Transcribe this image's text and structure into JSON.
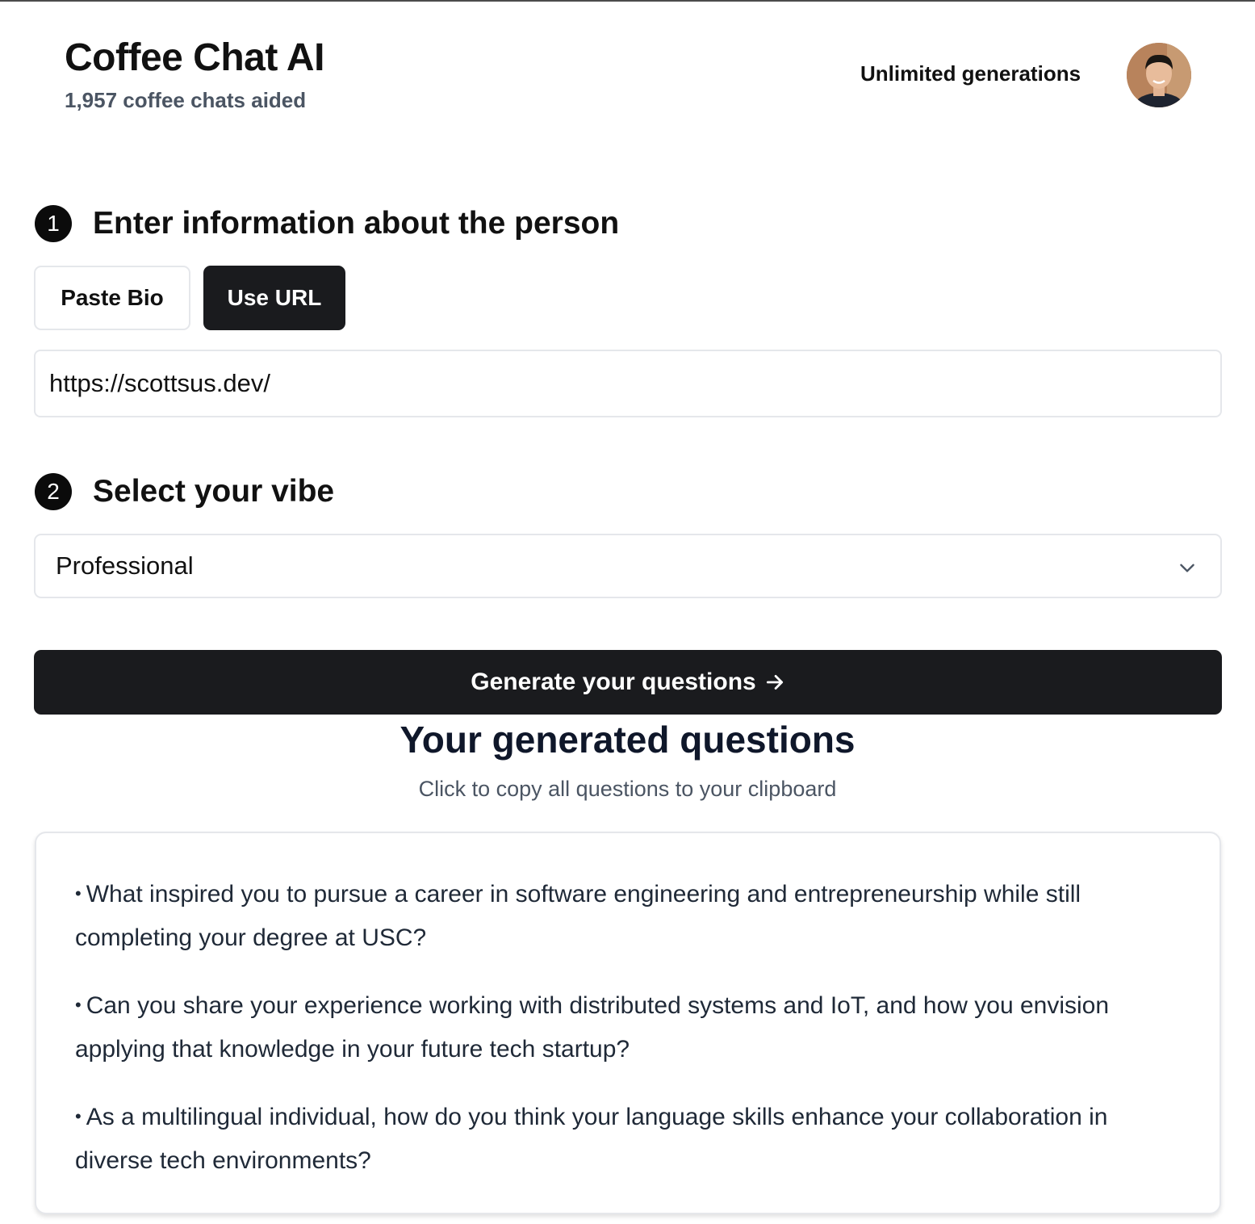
{
  "header": {
    "title": "Coffee Chat AI",
    "subtitle": "1,957 coffee chats aided",
    "plan_label": "Unlimited generations"
  },
  "step1": {
    "number": "1",
    "title": "Enter information about the person",
    "tabs": [
      {
        "label": "Paste Bio",
        "active": false
      },
      {
        "label": "Use URL",
        "active": true
      }
    ],
    "url_value": "https://scottsus.dev/"
  },
  "step2": {
    "number": "2",
    "title": "Select your vibe",
    "selected_vibe": "Professional"
  },
  "generate_button": {
    "label": "Generate your questions",
    "icon": "arrow-right-icon"
  },
  "results": {
    "title": "Your generated questions",
    "subtitle": "Click to copy all questions to your clipboard",
    "bullet": "•",
    "questions": [
      "What inspired you to pursue a career in software engineering and entrepreneurship while still completing your degree at USC?",
      "Can you share your experience working with distributed systems and IoT, and how you envision applying that knowledge in your future tech startup?",
      "As a multilingual individual, how do you think your language skills enhance your collaboration in diverse tech environments?"
    ]
  },
  "colors": {
    "primary_dark": "#1a1b1e",
    "subtitle_gray": "#4b5563",
    "border": "#e5e7eb"
  }
}
